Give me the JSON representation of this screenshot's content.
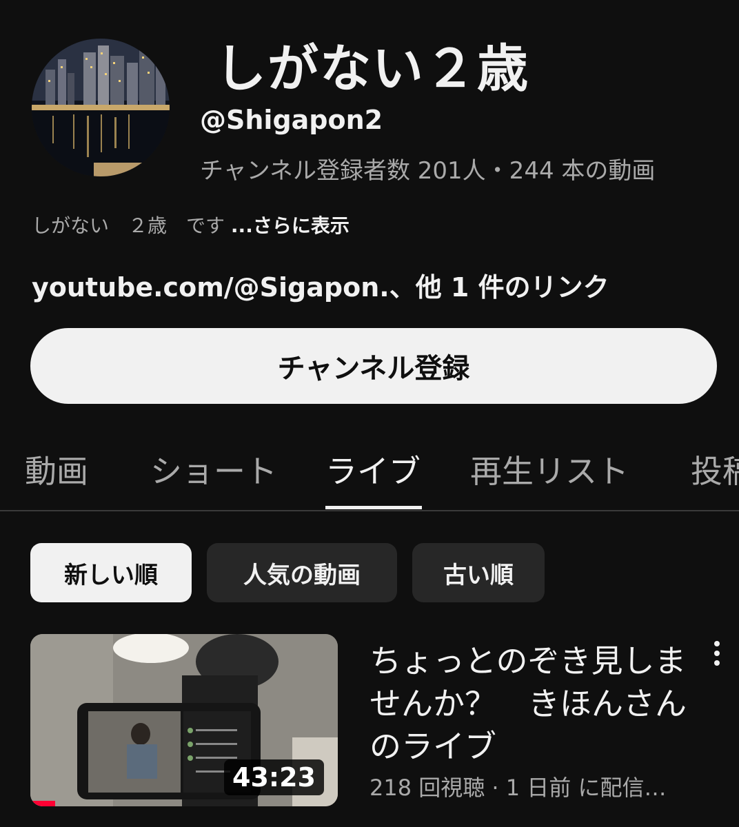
{
  "channel": {
    "name": "しがない２歳",
    "handle": "@Shigapon2",
    "stats": "チャンネル登録者数 201人・244 本の動画",
    "description": "しがない　２歳　です",
    "more_label": "...さらに表示",
    "links": "youtube.com/@Sigapon.、他 1 件のリンク",
    "subscribe_label": "チャンネル登録"
  },
  "tabs": [
    {
      "label": "動画"
    },
    {
      "label": "ショート"
    },
    {
      "label": "ライブ",
      "active": true
    },
    {
      "label": "再生リスト"
    },
    {
      "label": "投稿"
    }
  ],
  "chips": [
    {
      "label": "新しい順",
      "selected": true
    },
    {
      "label": "人気の動画"
    },
    {
      "label": "古い順"
    }
  ],
  "video": {
    "title": "ちょっとのぞき見しませんか？　きほんさんのライブ",
    "meta": "218 回視聴 · 1 日前 に配信…",
    "duration": "43:23",
    "progress": 0.08
  },
  "icons": {
    "more": "more-vertical-icon"
  },
  "colors": {
    "background": "#0f0f0f",
    "accent": "#ff0033"
  }
}
